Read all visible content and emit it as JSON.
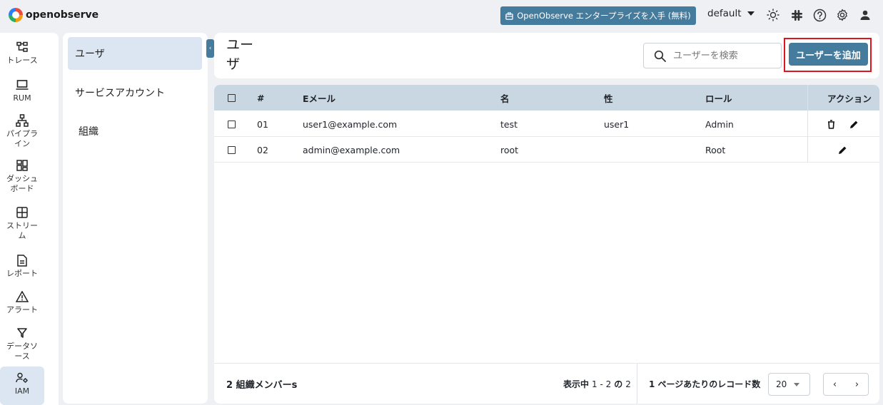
{
  "app": {
    "logo_text": "openobserve"
  },
  "topbar": {
    "enterprise_label": "OpenObserve エンタープライズを入手 (無料)",
    "org_value": "default"
  },
  "nav": {
    "items": [
      {
        "label": "トレース",
        "icon": "traces-icon"
      },
      {
        "label": "RUM",
        "icon": "rum-icon"
      },
      {
        "label": "パイプライン",
        "icon": "pipeline-icon"
      },
      {
        "label": "ダッシュボード",
        "icon": "dashboard-icon"
      },
      {
        "label": "ストリーム",
        "icon": "streams-icon"
      },
      {
        "label": "レポート",
        "icon": "report-icon"
      },
      {
        "label": "アラート",
        "icon": "alert-icon"
      },
      {
        "label": "データソース",
        "icon": "filter-icon"
      },
      {
        "label": "IAM",
        "icon": "iam-icon"
      }
    ]
  },
  "submenu": {
    "items": [
      {
        "label": "ユーザ"
      },
      {
        "label": "サービスアカウント"
      },
      {
        "label": "組織"
      }
    ]
  },
  "header": {
    "title": "ユーザ",
    "search_placeholder": "ユーザーを検索",
    "add_label": "ユーザーを追加"
  },
  "table": {
    "columns": [
      "#",
      "Eメール",
      "名",
      "性",
      "ロール",
      "アクション"
    ],
    "rows": [
      {
        "num": "01",
        "email": "user1@example.com",
        "first": "test",
        "last": "user1",
        "role": "Admin"
      },
      {
        "num": "02",
        "email": "admin@example.com",
        "first": "root",
        "last": "",
        "role": "Root"
      }
    ]
  },
  "footer": {
    "member_count": "2 組織メンバーs",
    "showing_prefix": "表示中",
    "showing_range": "1 - 2",
    "showing_of": "の",
    "showing_total": "2",
    "records_per_page_label": "1 ページあたりのレコード数",
    "per_page_value": "20"
  },
  "colors": {
    "accent": "#457b9d",
    "highlight": "#e0141e",
    "table_header": "#c9d7e2"
  }
}
